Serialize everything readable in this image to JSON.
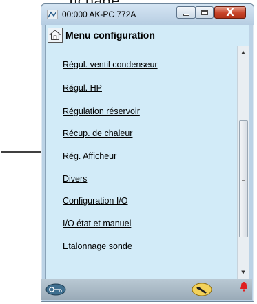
{
  "caption": {
    "text": "fichage"
  },
  "window": {
    "title": "00:000 AK-PC 772A",
    "buttons": {
      "close_label": "X"
    }
  },
  "menu": {
    "title": "Menu configuration",
    "items": [
      {
        "label": "Régul. ventil condenseur"
      },
      {
        "label": "Régul. HP"
      },
      {
        "label": "Régulation réservoir"
      },
      {
        "label": "Récup. de chaleur"
      },
      {
        "label": "Rég. Afficheur"
      },
      {
        "label": "Divers"
      },
      {
        "label": "Configuration I/O"
      },
      {
        "label": "I/O  état et manuel"
      },
      {
        "label": "Etalonnage sonde"
      }
    ]
  },
  "annotation": {
    "pointer_target": "Rég. Afficheur"
  },
  "colors": {
    "panel_bg": "#d2ebf8",
    "titlebar": "#c6d9ea",
    "close_button": "#c9452a",
    "alarm": "#e02020"
  },
  "icons": [
    "window-icon",
    "home-icon",
    "key-icon",
    "wrench-icon",
    "alarm-bell-icon",
    "arrow-icon"
  ]
}
